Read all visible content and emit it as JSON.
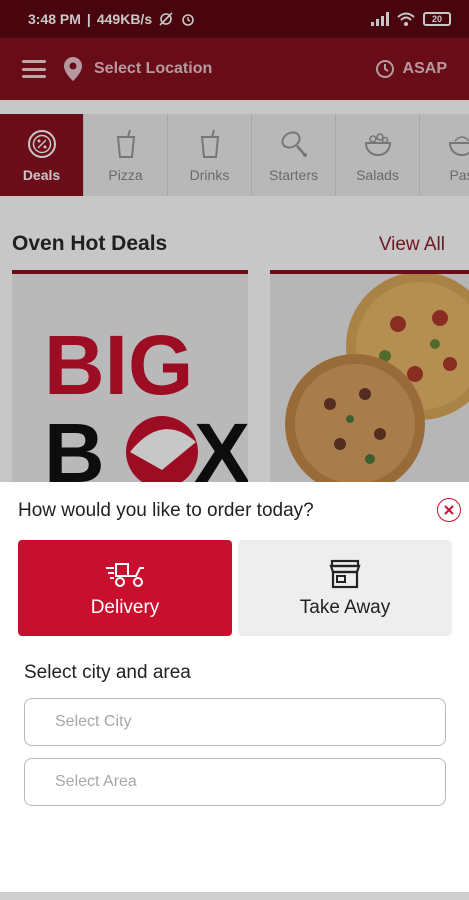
{
  "status_bar": {
    "time": "3:48 PM",
    "network_speed": "449KB/s",
    "battery": "20"
  },
  "header": {
    "location_label": "Select Location",
    "time_label": "ASAP"
  },
  "categories": [
    {
      "label": "Deals",
      "icon": "percent-icon",
      "active": true
    },
    {
      "label": "Pizza",
      "icon": "cup-icon",
      "active": false
    },
    {
      "label": "Drinks",
      "icon": "cup-icon",
      "active": false
    },
    {
      "label": "Starters",
      "icon": "chicken-leg-icon",
      "active": false
    },
    {
      "label": "Salads",
      "icon": "salad-bowl-icon",
      "active": false
    },
    {
      "label": "Pas",
      "icon": "bowl-icon",
      "active": false
    }
  ],
  "deals": {
    "title": "Oven Hot Deals",
    "view_all": "View All",
    "card1_text_line1": "BIG",
    "card1_text_line2": "B",
    "card1_text_line3": "X"
  },
  "order_sheet": {
    "title": "How would you like to order today?",
    "delivery_label": "Delivery",
    "takeaway_label": "Take Away",
    "select_title": "Select city and area",
    "city_placeholder": "Select City",
    "area_placeholder": "Select Area"
  },
  "colors": {
    "brand_red": "#c8102e",
    "header_red": "#86111f",
    "status_red": "#5e0712"
  }
}
